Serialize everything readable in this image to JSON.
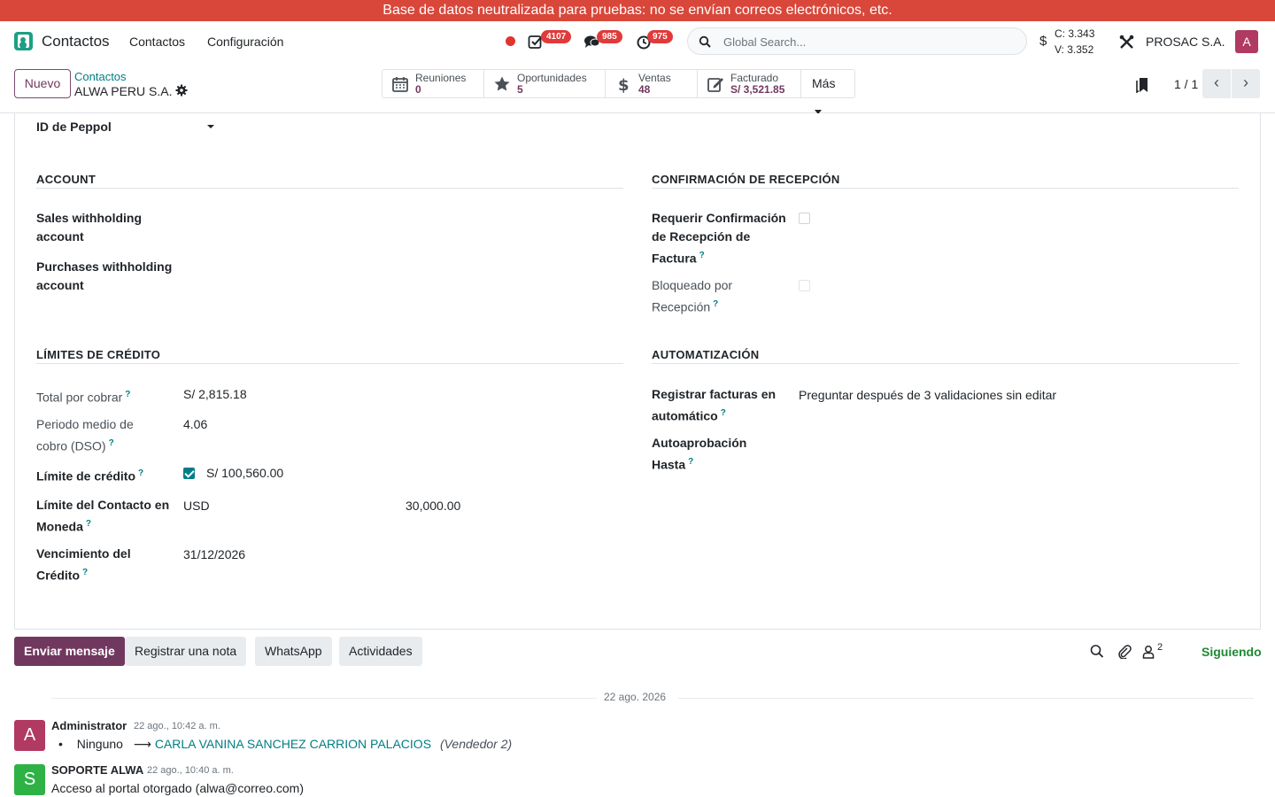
{
  "banner": {
    "text": "Base de datos neutralizada para pruebas: no se envían correos electrónicos, etc."
  },
  "navbar": {
    "app_name": "Contactos",
    "menu": [
      "Contactos",
      "Configuración"
    ],
    "badges": {
      "activities": "4107",
      "messages": "985",
      "timesheets": "975"
    },
    "search_placeholder": "Global Search...",
    "currency_symbol": "$",
    "rate_buy": "C: 3.343",
    "rate_sell": "V: 3.352",
    "company": "PROSAC S.A.",
    "user_initial": "A"
  },
  "control": {
    "new_label": "Nuevo",
    "breadcrumb": "Contactos",
    "record_name": "ALWA PERU S.A.",
    "smart_buttons": [
      {
        "label": "Reuniones",
        "value": "0",
        "icon": "calendar-icon"
      },
      {
        "label": "Oportunidades",
        "value": "5",
        "icon": "star-icon"
      },
      {
        "label": "Ventas",
        "value": "48",
        "icon": "dollar-icon"
      },
      {
        "label": "Facturado",
        "value": "S/ 3,521.85",
        "icon": "edit-icon"
      }
    ],
    "more_label": "Más",
    "pager": "1 / 1"
  },
  "form": {
    "peppol_label": "ID de Peppol",
    "account": {
      "title": "ACCOUNT",
      "sales_withholding_1": "Sales withholding",
      "sales_withholding_2": "account",
      "purchases_withholding_1": "Purchases withholding",
      "purchases_withholding_2": "account"
    },
    "reception": {
      "title": "CONFIRMACIÓN DE RECEPCIÓN",
      "require_1": "Requerir Confirmación",
      "require_2": "de Recepción de",
      "require_3": "Factura",
      "require_checked": false,
      "blocked_1": "Bloqueado por",
      "blocked_2": "Recepción",
      "blocked_checked": false
    },
    "credit": {
      "title": "LÍMITES DE CRÉDITO",
      "total_label": "Total por cobrar",
      "total_value": "S/ 2,815.18",
      "dso_label_1": "Periodo medio de",
      "dso_label_2": "cobro (DSO)",
      "dso_value": "4.06",
      "limit_label": "Límite de crédito",
      "limit_checked": true,
      "limit_value": "S/ 100,560.00",
      "contact_limit_1": "Límite del Contacto en",
      "contact_limit_2": "Moneda",
      "contact_currency": "USD",
      "contact_amount": "30,000.00",
      "due_label_1": "Vencimiento del",
      "due_label_2": "Crédito",
      "due_value": "31/12/2026"
    },
    "automation": {
      "title": "AUTOMATIZACIÓN",
      "register_1": "Registrar facturas en",
      "register_2": "automático",
      "register_value": "Preguntar después de 3 validaciones sin editar",
      "approve_1": "Autoaprobación",
      "approve_2": "Hasta"
    },
    "help_mark": "?"
  },
  "chatter": {
    "send_message": "Enviar mensaje",
    "log_note": "Registrar una nota",
    "whatsapp": "WhatsApp",
    "activities": "Actividades",
    "followers_count": "2",
    "following": "Siguiendo",
    "date_separator": "22 ago. 2026",
    "messages": [
      {
        "avatar": "A",
        "avatar_color": "#b03a62",
        "author": "Administrator",
        "date": "22 ago., 10:42 a. m.",
        "old_value": "Ninguno",
        "arrow": "⟶",
        "new_value": "CARLA VANINA SANCHEZ CARRION PALACIOS",
        "field": "(Vendedor 2)"
      },
      {
        "avatar": "S",
        "avatar_color": "#2fb245",
        "author": "SOPORTE ALWA",
        "date": "22 ago., 10:40 a. m.",
        "body": "Acceso al portal otorgado (alwa@correo.com)"
      }
    ]
  }
}
